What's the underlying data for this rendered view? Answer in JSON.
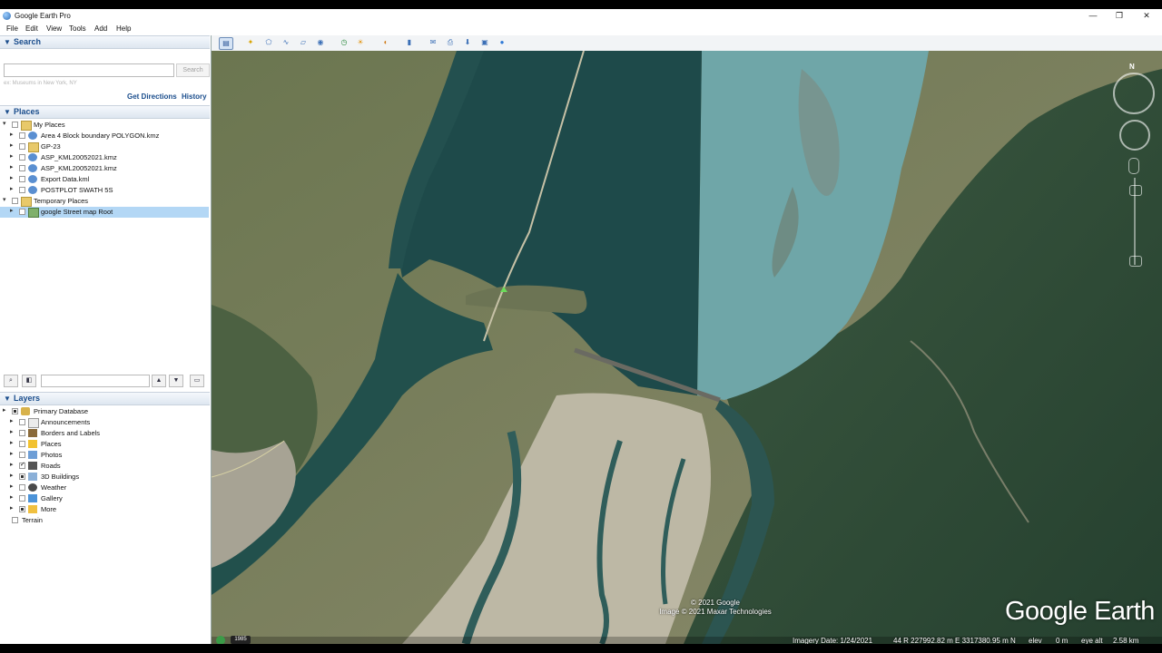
{
  "window": {
    "title": "Google Earth Pro",
    "controls": [
      "—",
      "❐",
      "✕"
    ]
  },
  "menu": [
    "File",
    "Edit",
    "View",
    "Tools",
    "Add",
    "Help"
  ],
  "search": {
    "header": "Search",
    "placeholder": "",
    "button": "Search",
    "hint": "ex: Museums in New York, NY",
    "get_directions": "Get Directions",
    "history": "History"
  },
  "places": {
    "header": "Places",
    "items": [
      {
        "label": "My Places",
        "level": 0,
        "expanded": true,
        "icon": "folder-icon",
        "checked": false
      },
      {
        "label": "Area 4 Block boundary POLYGON.kmz",
        "level": 1,
        "icon": "kml-network-icon",
        "checked": false
      },
      {
        "label": "GP-23",
        "level": 1,
        "icon": "folder-icon",
        "checked": false
      },
      {
        "label": "ASP_KML20052021.kmz",
        "level": 1,
        "icon": "kml-network-icon",
        "checked": false
      },
      {
        "label": "ASP_KML20052021.kmz",
        "level": 1,
        "icon": "kml-network-icon",
        "checked": false
      },
      {
        "label": "Export Data.kml",
        "level": 1,
        "icon": "kml-network-icon",
        "checked": false
      },
      {
        "label": "POSTPLOT SWATH 5S",
        "level": 1,
        "icon": "kml-network-icon",
        "checked": false
      },
      {
        "label": "Temporary Places",
        "level": 0,
        "expanded": true,
        "icon": "folder-icon",
        "checked": false
      },
      {
        "label": "google Street map Root",
        "level": 1,
        "icon": "image-overlay-icon",
        "checked": false,
        "selected": true
      }
    ]
  },
  "layers": {
    "header": "Layers",
    "items": [
      {
        "label": "Primary Database",
        "level": 0,
        "icon": "database-icon",
        "state": "partial"
      },
      {
        "label": "Announcements",
        "level": 1,
        "icon": "announcement-icon",
        "state": "off"
      },
      {
        "label": "Borders and Labels",
        "level": 1,
        "icon": "flag-icon",
        "state": "off"
      },
      {
        "label": "Places",
        "level": 1,
        "icon": "places-icon",
        "state": "off"
      },
      {
        "label": "Photos",
        "level": 1,
        "icon": "photo-icon",
        "state": "off"
      },
      {
        "label": "Roads",
        "level": 1,
        "icon": "road-icon",
        "state": "checked"
      },
      {
        "label": "3D Buildings",
        "level": 1,
        "icon": "building-icon",
        "state": "partial"
      },
      {
        "label": "Weather",
        "level": 1,
        "icon": "weather-icon",
        "state": "off"
      },
      {
        "label": "Gallery",
        "level": 1,
        "icon": "gallery-icon",
        "state": "off"
      },
      {
        "label": "More",
        "level": 1,
        "icon": "more-icon",
        "state": "partial"
      },
      {
        "label": "Terrain",
        "level": 0,
        "icon": "",
        "state": "off"
      }
    ]
  },
  "map": {
    "copyright_1": "© 2021 Google",
    "copyright_2": "Image © 2021 Maxar Technologies",
    "logo": "Google Earth",
    "compass_letter": "N",
    "status": {
      "year": "1985",
      "imagery_date": "Imagery Date: 1/24/2021",
      "coords": "44 R 227992.82 m E 3317380.95 m N",
      "elev_label": "elev",
      "elev_value": "0 m",
      "eye_alt_label": "eye alt",
      "eye_alt_value": "2.58 km"
    }
  },
  "colors": {
    "accent": "#1a4d8c",
    "selection": "#b3d7f5",
    "river_left": "#1e4a4a",
    "river_right": "#6fa6a8",
    "forest": "#2d4a36"
  }
}
